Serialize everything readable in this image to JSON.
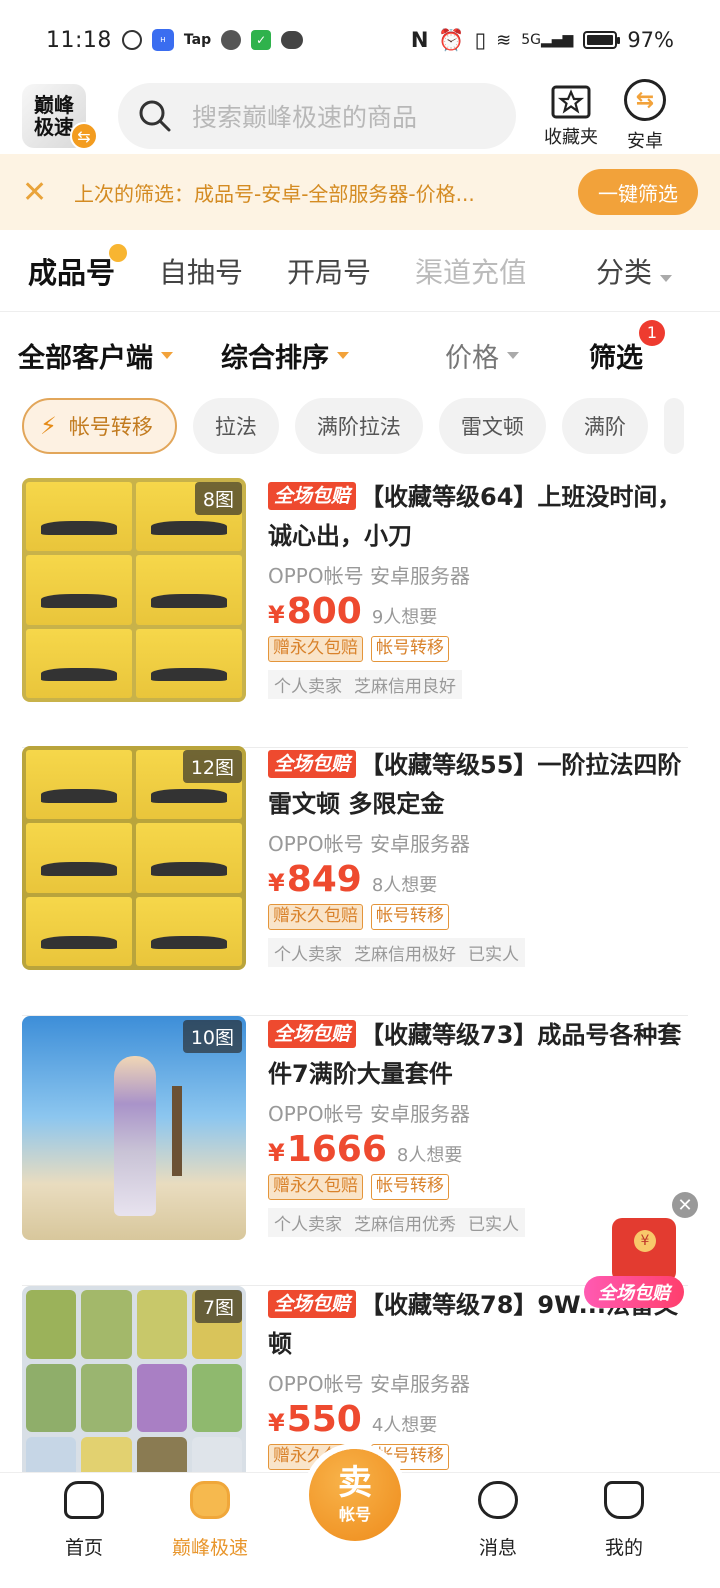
{
  "status": {
    "time": "11:18",
    "tap_label": "Tap",
    "battery": "97%",
    "network": "5G"
  },
  "header": {
    "logo_text": "巅峰极速",
    "search_placeholder": "搜索巅峰极速的商品",
    "favorites_label": "收藏夹",
    "platform_label": "安卓"
  },
  "filter_banner": {
    "text": "上次的筛选：成品号-安卓-全部服务器-价格...",
    "button_label": "一键筛选"
  },
  "tabs": [
    "成品号",
    "自抽号",
    "开局号",
    "渠道充值",
    "分类"
  ],
  "sort": {
    "client": "全部客户端",
    "order": "综合排序",
    "price": "价格",
    "filter": "筛选",
    "filter_count": "1"
  },
  "chips": [
    "帐号转移",
    "拉法",
    "满阶拉法",
    "雷文顿",
    "满阶"
  ],
  "listings": [
    {
      "tag": "全场包赔",
      "title": "【收藏等级64】上班没时间，诚心出，小刀",
      "sub": "OPPO帐号 安卓服务器",
      "price": "800",
      "want": "9人想要",
      "tags": [
        "赠永久包赔",
        "帐号转移"
      ],
      "seller": [
        "个人卖家",
        "芝麻信用良好"
      ],
      "img_count": "8图"
    },
    {
      "tag": "全场包赔",
      "title": "【收藏等级55】一阶拉法四阶雷文顿 多限定金",
      "sub": "OPPO帐号 安卓服务器",
      "price": "849",
      "want": "8人想要",
      "tags": [
        "赠永久包赔",
        "帐号转移"
      ],
      "seller": [
        "个人卖家",
        "芝麻信用极好",
        "已实人"
      ],
      "img_count": "12图"
    },
    {
      "tag": "全场包赔",
      "title": "【收藏等级73】成品号各种套件7满阶大量套件",
      "sub": "OPPO帐号 安卓服务器",
      "price": "1666",
      "want": "8人想要",
      "tags": [
        "赠永久包赔",
        "帐号转移"
      ],
      "seller": [
        "个人卖家",
        "芝麻信用优秀",
        "已实人"
      ],
      "img_count": "10图"
    },
    {
      "tag": "全场包赔",
      "title": "【收藏等级78】9W...法雷文顿",
      "sub": "OPPO帐号 安卓服务器",
      "price": "550",
      "want": "4人想要",
      "tags": [
        "赠永久包赔",
        "帐号转移"
      ],
      "seller": [],
      "img_count": "7图"
    }
  ],
  "promo": {
    "label": "全场包赔"
  },
  "bottom_nav": {
    "home": "首页",
    "game": "巅峰极速",
    "sell_big": "卖",
    "sell_small": "帐号",
    "messages": "消息",
    "mine": "我的"
  },
  "colors": {
    "accent": "#f2a23a",
    "price": "#ee4a2f",
    "banner_bg": "#fdf3e3"
  }
}
